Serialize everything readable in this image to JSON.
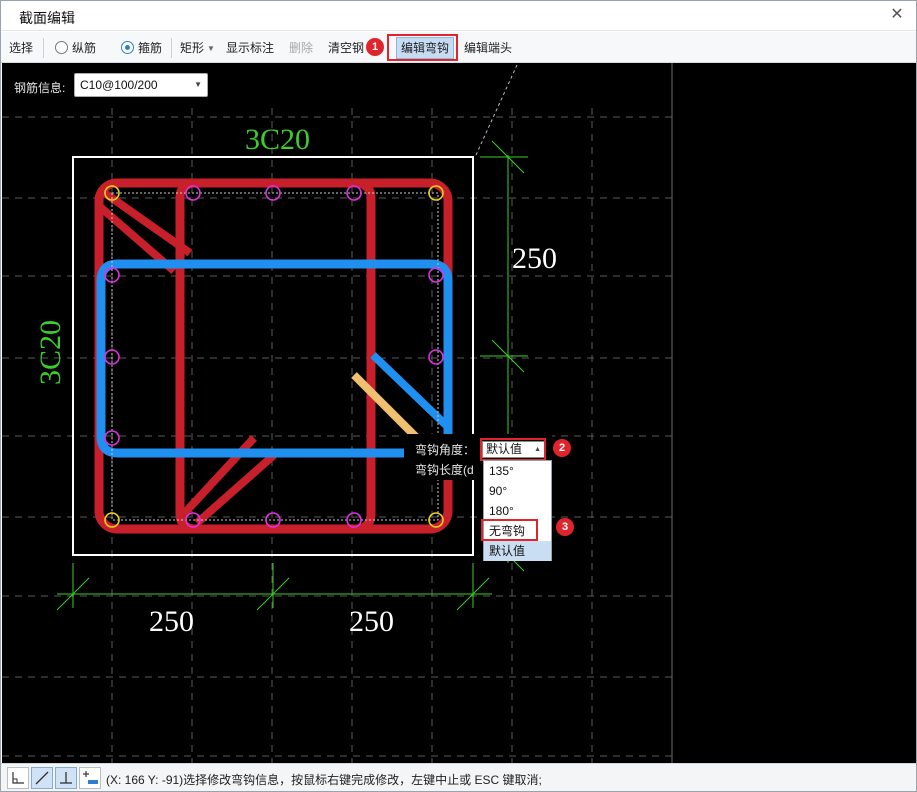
{
  "window": {
    "title": "截面编辑",
    "close_glyph": "✕"
  },
  "toolbar": {
    "select": "选择",
    "longitudinal": "纵筋",
    "stirrup": "箍筋",
    "shape": "矩形",
    "show_dims": "显示标注",
    "delete": "删除",
    "clear": "清空钢",
    "edit_hook": "编辑弯钩",
    "edit_end": "编辑端头"
  },
  "badges": {
    "b1": "1",
    "b2": "2",
    "b3": "3"
  },
  "rebar_info": {
    "label": "钢筋信息:",
    "value": "C10@100/200"
  },
  "labels": {
    "top_rebar": "3C20",
    "left_rebar": "3C20",
    "dim_right": "250",
    "dim_bottom_left": "250",
    "dim_bottom_right": "250"
  },
  "hook_popup": {
    "angle_label": "弯钩角度：",
    "length_label": "弯钩长度(d",
    "selected": "默认值",
    "options": [
      "135°",
      "90°",
      "180°",
      "无弯钩",
      "默认值"
    ]
  },
  "statusbar": {
    "text": "(X: 166 Y: -91)选择修改弯钩信息，按鼠标右键完成修改，左键中止或 ESC 键取消;"
  },
  "colors": {
    "stirrup_red": "#c8202a",
    "stirrup_blue": "#1f8ff0",
    "hook_orange": "#f0c070",
    "dim_green": "#3ccf2a",
    "accent_red": "#e0242c"
  }
}
